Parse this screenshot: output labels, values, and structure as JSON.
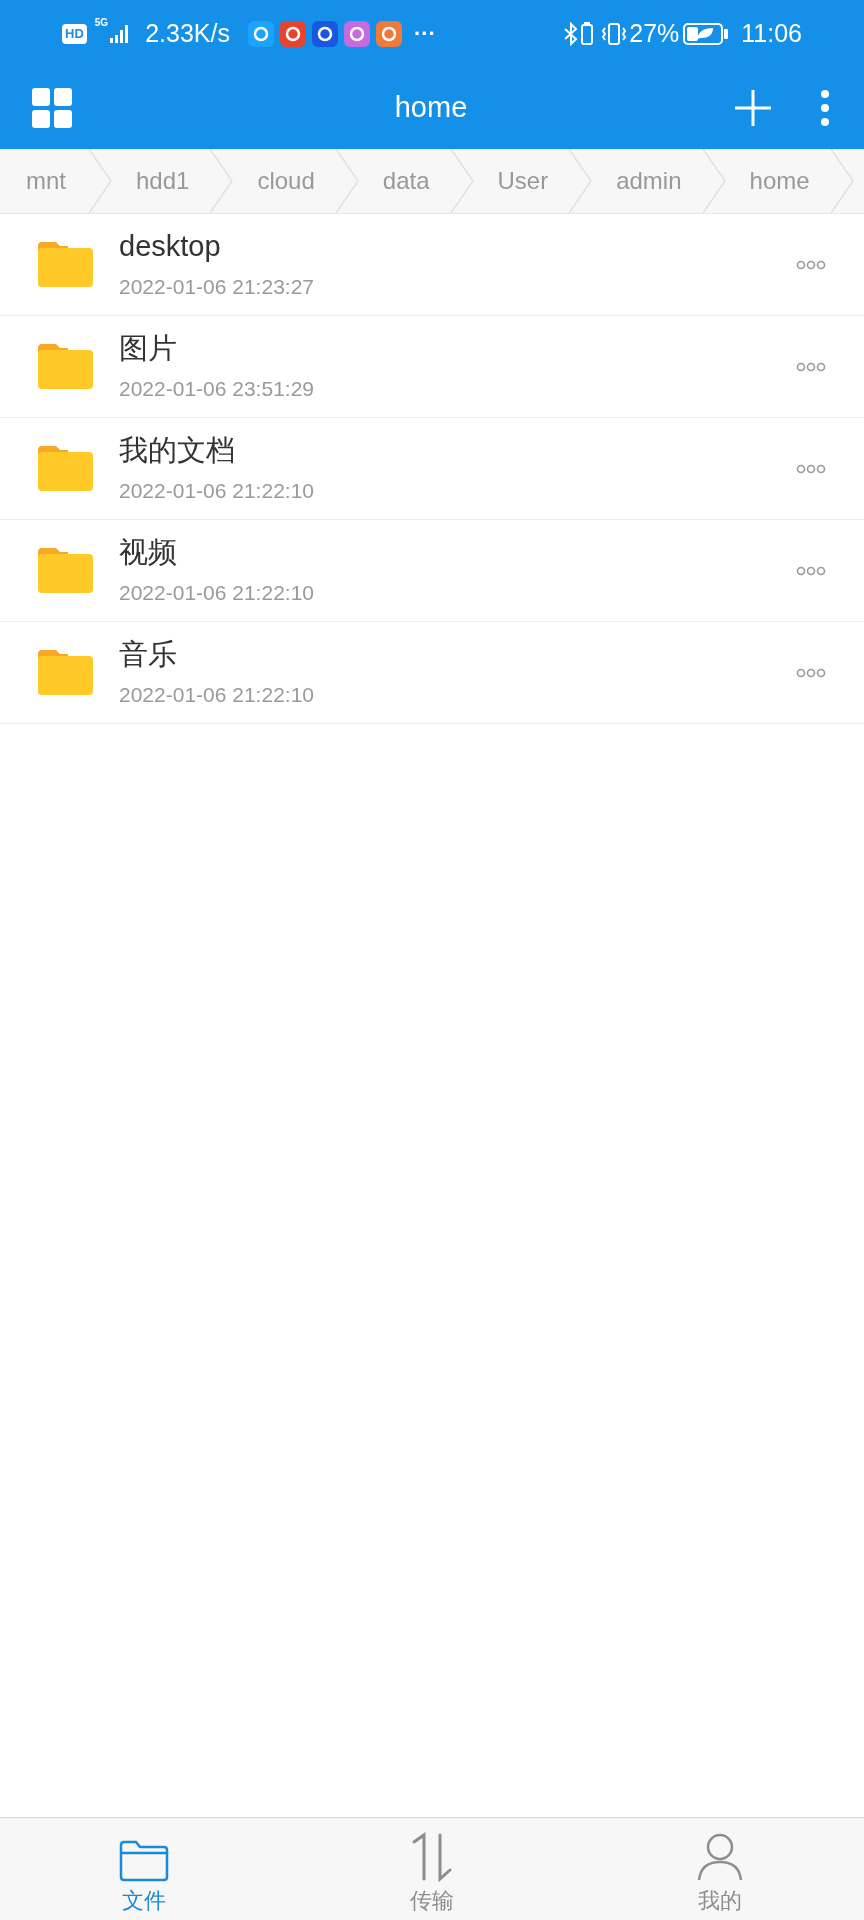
{
  "status_bar": {
    "network_badge": "HD",
    "network_type": "5G",
    "speed": "2.33K/s",
    "more": "···",
    "battery_percent": "27%",
    "time": "11:06"
  },
  "header": {
    "title": "home"
  },
  "breadcrumb": [
    {
      "label": "mnt"
    },
    {
      "label": "hdd1"
    },
    {
      "label": "cloud"
    },
    {
      "label": "data"
    },
    {
      "label": "User"
    },
    {
      "label": "admin"
    },
    {
      "label": "home"
    }
  ],
  "files": [
    {
      "name": "desktop",
      "modified": "2022-01-06 21:23:27"
    },
    {
      "name": "图片",
      "modified": "2022-01-06 23:51:29"
    },
    {
      "name": "我的文档",
      "modified": "2022-01-06 21:22:10"
    },
    {
      "name": "视频",
      "modified": "2022-01-06 21:22:10"
    },
    {
      "name": "音乐",
      "modified": "2022-01-06 21:22:10"
    }
  ],
  "bottom_nav": [
    {
      "label": "文件",
      "kind": "files",
      "selected": true
    },
    {
      "label": "传输",
      "kind": "transfer",
      "selected": false
    },
    {
      "label": "我的",
      "kind": "profile",
      "selected": false
    }
  ]
}
